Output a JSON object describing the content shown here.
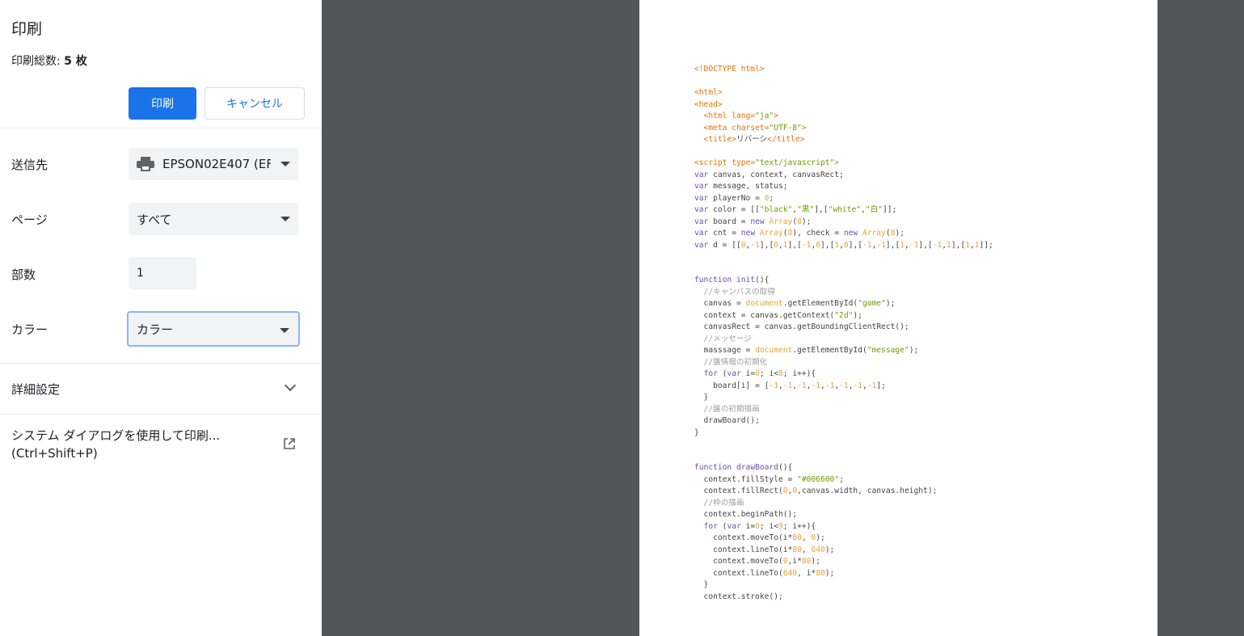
{
  "panel": {
    "title": "印刷",
    "sheets_label": "印刷総数: ",
    "sheets_count": "5 枚",
    "print_button": "印刷",
    "cancel_button": "キャンセル",
    "destination_label": "送信先",
    "destination_value": "EPSON02E407 (EF",
    "pages_label": "ページ",
    "pages_value": "すべて",
    "copies_label": "部数",
    "copies_value": "1",
    "color_label": "カラー",
    "color_value": "カラー",
    "advanced_label": "詳細設定",
    "system_dialog_line1": "システム ダイアログを使用して印刷...",
    "system_dialog_line2": "(Ctrl+Shift+P)"
  },
  "colors": {
    "accent": "#1a73e8",
    "preview_bg": "#525659",
    "tag": "#e8710a",
    "keyword": "#6a4fb0",
    "string": "#6aa000",
    "number": "#e8a33a",
    "comment": "#9e9e9e"
  },
  "preview": {
    "code_lines": [
      [
        [
          "<!DOCTYPE html>",
          "tag"
        ]
      ],
      [],
      [
        [
          "<html>",
          "tag"
        ]
      ],
      [
        [
          "<head>",
          "tag"
        ]
      ],
      [
        [
          "  <html lang=",
          "tag"
        ],
        [
          "\"ja\"",
          "string"
        ],
        [
          ">",
          "tag"
        ]
      ],
      [
        [
          "  <meta charset=",
          "tag"
        ],
        [
          "\"UTF-8\"",
          "string"
        ],
        [
          ">",
          "tag"
        ]
      ],
      [
        [
          "  <title>",
          "tag"
        ],
        [
          "リバーシ",
          "plain"
        ],
        [
          "</title>",
          "tag"
        ]
      ],
      [],
      [
        [
          "<script type=",
          "tag"
        ],
        [
          "\"text/javascript\"",
          "string"
        ],
        [
          ">",
          "tag"
        ]
      ],
      [
        [
          "var",
          "keyword"
        ],
        [
          " canvas, context, canvasRect;",
          "plain"
        ]
      ],
      [
        [
          "var",
          "keyword"
        ],
        [
          " message, status;",
          "plain"
        ]
      ],
      [
        [
          "var",
          "keyword"
        ],
        [
          " playerNo = ",
          "plain"
        ],
        [
          "0",
          "number"
        ],
        [
          ";",
          "plain"
        ]
      ],
      [
        [
          "var",
          "keyword"
        ],
        [
          " color = [[",
          "plain"
        ],
        [
          "\"black\"",
          "string"
        ],
        [
          ",",
          "plain"
        ],
        [
          "\"黒\"",
          "string"
        ],
        [
          "],[",
          "plain"
        ],
        [
          "\"white\"",
          "string"
        ],
        [
          ",",
          "plain"
        ],
        [
          "\"白\"",
          "string"
        ],
        [
          "]];",
          "plain"
        ]
      ],
      [
        [
          "var",
          "keyword"
        ],
        [
          " board = ",
          "plain"
        ],
        [
          "new",
          "keyword"
        ],
        [
          " ",
          "plain"
        ],
        [
          "Array",
          "number"
        ],
        [
          "(",
          "plain"
        ],
        [
          "8",
          "number"
        ],
        [
          ");",
          "plain"
        ]
      ],
      [
        [
          "var",
          "keyword"
        ],
        [
          " cnt = ",
          "plain"
        ],
        [
          "new",
          "keyword"
        ],
        [
          " ",
          "plain"
        ],
        [
          "Array",
          "number"
        ],
        [
          "(",
          "plain"
        ],
        [
          "8",
          "number"
        ],
        [
          "), check = ",
          "plain"
        ],
        [
          "new",
          "keyword"
        ],
        [
          " ",
          "plain"
        ],
        [
          "Array",
          "number"
        ],
        [
          "(",
          "plain"
        ],
        [
          "8",
          "number"
        ],
        [
          ");",
          "plain"
        ]
      ],
      [
        [
          "var",
          "keyword"
        ],
        [
          " d = [[",
          "plain"
        ],
        [
          "0",
          "number"
        ],
        [
          ",",
          "plain"
        ],
        [
          "-1",
          "number"
        ],
        [
          "],[",
          "plain"
        ],
        [
          "0",
          "number"
        ],
        [
          ",",
          "plain"
        ],
        [
          "1",
          "number"
        ],
        [
          "],[",
          "plain"
        ],
        [
          "-1",
          "number"
        ],
        [
          ",",
          "plain"
        ],
        [
          "0",
          "number"
        ],
        [
          "],[",
          "plain"
        ],
        [
          "1",
          "number"
        ],
        [
          ",",
          "plain"
        ],
        [
          "0",
          "number"
        ],
        [
          "],[",
          "plain"
        ],
        [
          "-1",
          "number"
        ],
        [
          ",",
          "plain"
        ],
        [
          "-1",
          "number"
        ],
        [
          "],[",
          "plain"
        ],
        [
          "1",
          "number"
        ],
        [
          ",",
          "plain"
        ],
        [
          "-1",
          "number"
        ],
        [
          "],[",
          "plain"
        ],
        [
          "-1",
          "number"
        ],
        [
          ",",
          "plain"
        ],
        [
          "1",
          "number"
        ],
        [
          "],[",
          "plain"
        ],
        [
          "1",
          "number"
        ],
        [
          ",",
          "plain"
        ],
        [
          "1",
          "number"
        ],
        [
          "]];",
          "plain"
        ]
      ],
      [],
      [],
      [
        [
          "function",
          "keyword"
        ],
        [
          " ",
          "plain"
        ],
        [
          "init",
          "keyword"
        ],
        [
          "(){",
          "plain"
        ]
      ],
      [
        [
          "  //キャンバスの取得",
          "comment"
        ]
      ],
      [
        [
          "  canvas = ",
          "plain"
        ],
        [
          "document",
          "number"
        ],
        [
          ".getElementById(",
          "plain"
        ],
        [
          "\"game\"",
          "string"
        ],
        [
          ");",
          "plain"
        ]
      ],
      [
        [
          "  context = canvas.getContext(",
          "plain"
        ],
        [
          "\"2d\"",
          "string"
        ],
        [
          ");",
          "plain"
        ]
      ],
      [
        [
          "  canvasRect = canvas.getBoundingClientRect();",
          "plain"
        ]
      ],
      [
        [
          "  //メッセージ",
          "comment"
        ]
      ],
      [
        [
          "  masssage = ",
          "plain"
        ],
        [
          "document",
          "number"
        ],
        [
          ".getElementById(",
          "plain"
        ],
        [
          "\"message\"",
          "string"
        ],
        [
          ");",
          "plain"
        ]
      ],
      [
        [
          "  //盤情報の初期化",
          "comment"
        ]
      ],
      [
        [
          "  ",
          "plain"
        ],
        [
          "for",
          "keyword"
        ],
        [
          " (",
          "plain"
        ],
        [
          "var",
          "keyword"
        ],
        [
          " i=",
          "plain"
        ],
        [
          "0",
          "number"
        ],
        [
          "; i<",
          "plain"
        ],
        [
          "8",
          "number"
        ],
        [
          "; i++){",
          "plain"
        ]
      ],
      [
        [
          "    board[i] = [",
          "plain"
        ],
        [
          "-1",
          "number"
        ],
        [
          ",",
          "plain"
        ],
        [
          "-1",
          "number"
        ],
        [
          ",",
          "plain"
        ],
        [
          "-1",
          "number"
        ],
        [
          ",",
          "plain"
        ],
        [
          "-1",
          "number"
        ],
        [
          ",",
          "plain"
        ],
        [
          "-1",
          "number"
        ],
        [
          ",",
          "plain"
        ],
        [
          "-1",
          "number"
        ],
        [
          ",",
          "plain"
        ],
        [
          "-1",
          "number"
        ],
        [
          ",",
          "plain"
        ],
        [
          "-1",
          "number"
        ],
        [
          "];",
          "plain"
        ]
      ],
      [
        [
          "  }",
          "plain"
        ]
      ],
      [
        [
          "  //盤の初期描画",
          "comment"
        ]
      ],
      [
        [
          "  drawBoard();",
          "plain"
        ]
      ],
      [
        [
          "}",
          "plain"
        ]
      ],
      [],
      [],
      [
        [
          "function",
          "keyword"
        ],
        [
          " ",
          "plain"
        ],
        [
          "drawBoard",
          "keyword"
        ],
        [
          "(){",
          "plain"
        ]
      ],
      [
        [
          "  context.fillStyle = ",
          "plain"
        ],
        [
          "\"#006600\"",
          "string"
        ],
        [
          ";",
          "plain"
        ]
      ],
      [
        [
          "  context.fillRect(",
          "plain"
        ],
        [
          "0",
          "number"
        ],
        [
          ",",
          "plain"
        ],
        [
          "0",
          "number"
        ],
        [
          ",canvas.width, canvas.height);",
          "plain"
        ]
      ],
      [
        [
          "  //枠の描画",
          "comment"
        ]
      ],
      [
        [
          "  context.beginPath();",
          "plain"
        ]
      ],
      [
        [
          "  ",
          "plain"
        ],
        [
          "for",
          "keyword"
        ],
        [
          " (",
          "plain"
        ],
        [
          "var",
          "keyword"
        ],
        [
          " i=",
          "plain"
        ],
        [
          "0",
          "number"
        ],
        [
          "; i<",
          "plain"
        ],
        [
          "9",
          "number"
        ],
        [
          "; i++){",
          "plain"
        ]
      ],
      [
        [
          "    context.moveTo(i*",
          "plain"
        ],
        [
          "80",
          "number"
        ],
        [
          ", ",
          "plain"
        ],
        [
          "0",
          "number"
        ],
        [
          ");",
          "plain"
        ]
      ],
      [
        [
          "    context.lineTo(i*",
          "plain"
        ],
        [
          "80",
          "number"
        ],
        [
          ", ",
          "plain"
        ],
        [
          "640",
          "number"
        ],
        [
          ");",
          "plain"
        ]
      ],
      [
        [
          "    context.moveTo(",
          "plain"
        ],
        [
          "0",
          "number"
        ],
        [
          ",i*",
          "plain"
        ],
        [
          "80",
          "number"
        ],
        [
          ");",
          "plain"
        ]
      ],
      [
        [
          "    context.lineTo(",
          "plain"
        ],
        [
          "640",
          "number"
        ],
        [
          ", i*",
          "plain"
        ],
        [
          "80",
          "number"
        ],
        [
          ");",
          "plain"
        ]
      ],
      [
        [
          "  }",
          "plain"
        ]
      ],
      [
        [
          "  context.stroke();",
          "plain"
        ]
      ]
    ]
  }
}
